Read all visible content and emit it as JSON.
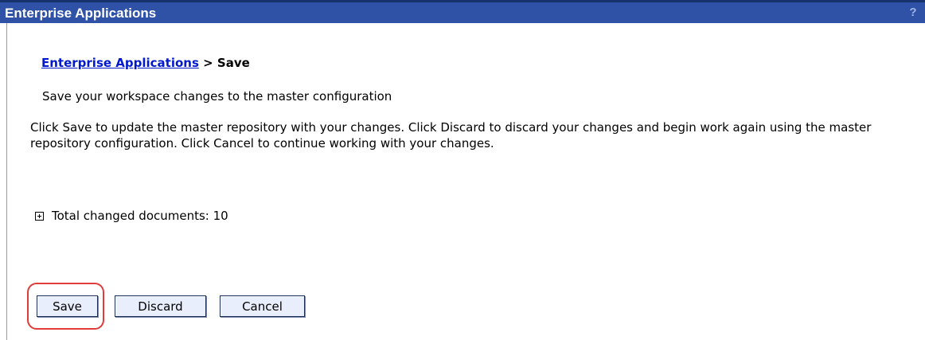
{
  "window": {
    "title": "Enterprise Applications",
    "help_icon": "?"
  },
  "breadcrumb": {
    "link_label": "Enterprise Applications",
    "separator": ">",
    "current": "Save"
  },
  "page": {
    "subtitle": "Save your workspace changes to the master configuration",
    "description": "Click Save to update the master repository with your changes. Click Discard to discard your changes and begin work again using the master repository configuration. Click Cancel to continue working with your changes.",
    "changed_documents_label": "Total changed documents: 10"
  },
  "buttons": {
    "save_label": "Save",
    "discard_label": "Discard",
    "cancel_label": "Cancel"
  },
  "icons": {
    "expand": "plus-box-icon",
    "help": "question-mark-icon"
  },
  "colors": {
    "titlebar": "#2f52a6",
    "link": "#0019cc",
    "button_face": "#e8eefb",
    "highlight": "#e23b3b"
  }
}
